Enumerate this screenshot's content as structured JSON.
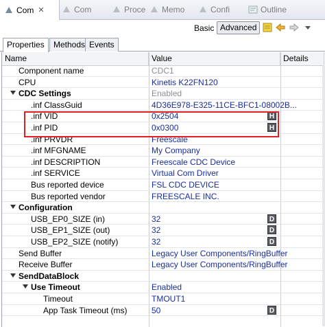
{
  "view_tabs": [
    {
      "label": "Com",
      "close": "✕",
      "active": true
    },
    {
      "label": "Com",
      "active": false
    },
    {
      "label": "Proce",
      "active": false
    },
    {
      "label": "Memo",
      "active": false
    },
    {
      "label": "Confi",
      "active": false
    },
    {
      "label": "Outline",
      "active": false
    }
  ],
  "toolbar": {
    "basic_label": "Basic",
    "advanced_label": "Advanced"
  },
  "property_tabs": [
    {
      "label": "Properties",
      "active": true
    },
    {
      "label": "Methods",
      "active": false
    },
    {
      "label": "Events",
      "active": false
    }
  ],
  "columns": {
    "name": "Name",
    "value": "Value",
    "details": "Details"
  },
  "rows": [
    {
      "name": "Component name",
      "value": "CDC1",
      "grey": true,
      "indent": 0
    },
    {
      "name": "CPU",
      "value": "Kinetis K22FN120",
      "indent": 0
    },
    {
      "name": "CDC Settings",
      "value": "Enabled",
      "grey": true,
      "bold": true,
      "expander": true,
      "indent": 0
    },
    {
      "name": ".inf ClassGuid",
      "value": "4D36E978-E325-11CE-BFC1-08002B...",
      "indent": 1
    },
    {
      "name": ".inf VID",
      "value": "0x2504",
      "badge": "H",
      "indent": 1
    },
    {
      "name": ".inf PID",
      "value": "0x0300",
      "badge": "H",
      "indent": 1
    },
    {
      "name": ".inf PRVDR",
      "value": "Freescale",
      "indent": 1
    },
    {
      "name": ".inf MFGNAME",
      "value": "My Company",
      "indent": 1
    },
    {
      "name": ".inf DESCRIPTION",
      "value": "Freescale CDC Device",
      "indent": 1
    },
    {
      "name": ".inf SERVICE",
      "value": "Virtual Com Driver",
      "indent": 1
    },
    {
      "name": "Bus reported device",
      "value": "FSL CDC DEVICE",
      "indent": 1
    },
    {
      "name": "Bus reported vendor",
      "value": "FREESCALE INC.",
      "indent": 1
    },
    {
      "name": "Configuration",
      "value": "",
      "bold": true,
      "expander": true,
      "indent": 0
    },
    {
      "name": "USB_EP0_SIZE (in)",
      "value": "32",
      "badge": "D",
      "indent": 1
    },
    {
      "name": "USB_EP1_SIZE (out)",
      "value": "32",
      "badge": "D",
      "indent": 1
    },
    {
      "name": "USB_EP2_SIZE (notify)",
      "value": "32",
      "badge": "D",
      "indent": 1
    },
    {
      "name": "Send Buffer",
      "value": "Legacy User Components/RingBuffer",
      "indent": 0
    },
    {
      "name": "Receive Buffer",
      "value": "Legacy User Components/RingBuffer",
      "indent": 0
    },
    {
      "name": "SendDataBlock",
      "value": "",
      "bold": true,
      "expander": true,
      "indent": 0
    },
    {
      "name": "Use Timeout",
      "value": "Enabled",
      "bold": true,
      "expander": true,
      "indent": 1
    },
    {
      "name": "Timeout",
      "value": "TMOUT1",
      "indent": 2
    },
    {
      "name": "App Task Timeout (ms)",
      "value": "50",
      "badge": "D",
      "indent": 2
    }
  ]
}
